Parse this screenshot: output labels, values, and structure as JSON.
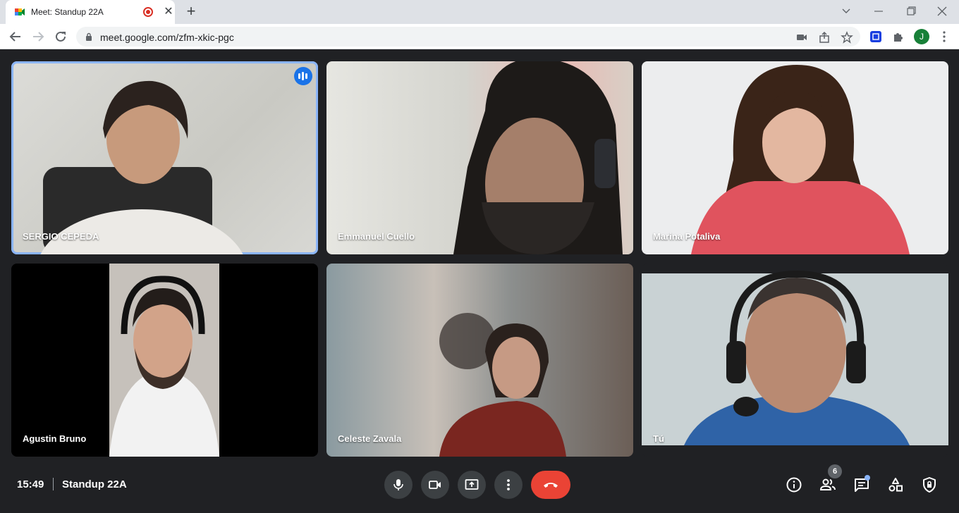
{
  "browser": {
    "tab_title": "Meet: Standup 22A",
    "url": "meet.google.com/zfm-xkic-pgc",
    "profile_initial": "J",
    "new_tab_symbol": "+",
    "close_symbol": "✕"
  },
  "meeting": {
    "time": "15:49",
    "name": "Standup 22A",
    "participant_count": "6"
  },
  "participants": [
    {
      "name": "SERGIO CEPEDA",
      "speaking": true
    },
    {
      "name": "Emmanuel Cuello"
    },
    {
      "name": "Marina Potaliva"
    },
    {
      "name": "Agustin Bruno"
    },
    {
      "name": "Celeste Zavala"
    },
    {
      "name": "Tú"
    }
  ],
  "controls": [
    "microphone-icon",
    "camera-icon",
    "present-screen-icon",
    "more-options-icon",
    "hang-up-icon"
  ],
  "side_controls": [
    "info-icon",
    "people-icon",
    "chat-icon",
    "activities-icon",
    "host-controls-icon"
  ],
  "colors": {
    "background": "#202124",
    "control": "#3c4043",
    "hangup": "#ea4335",
    "speaking_accent": "#1a73e8",
    "active_outline": "#8ab4f8"
  }
}
